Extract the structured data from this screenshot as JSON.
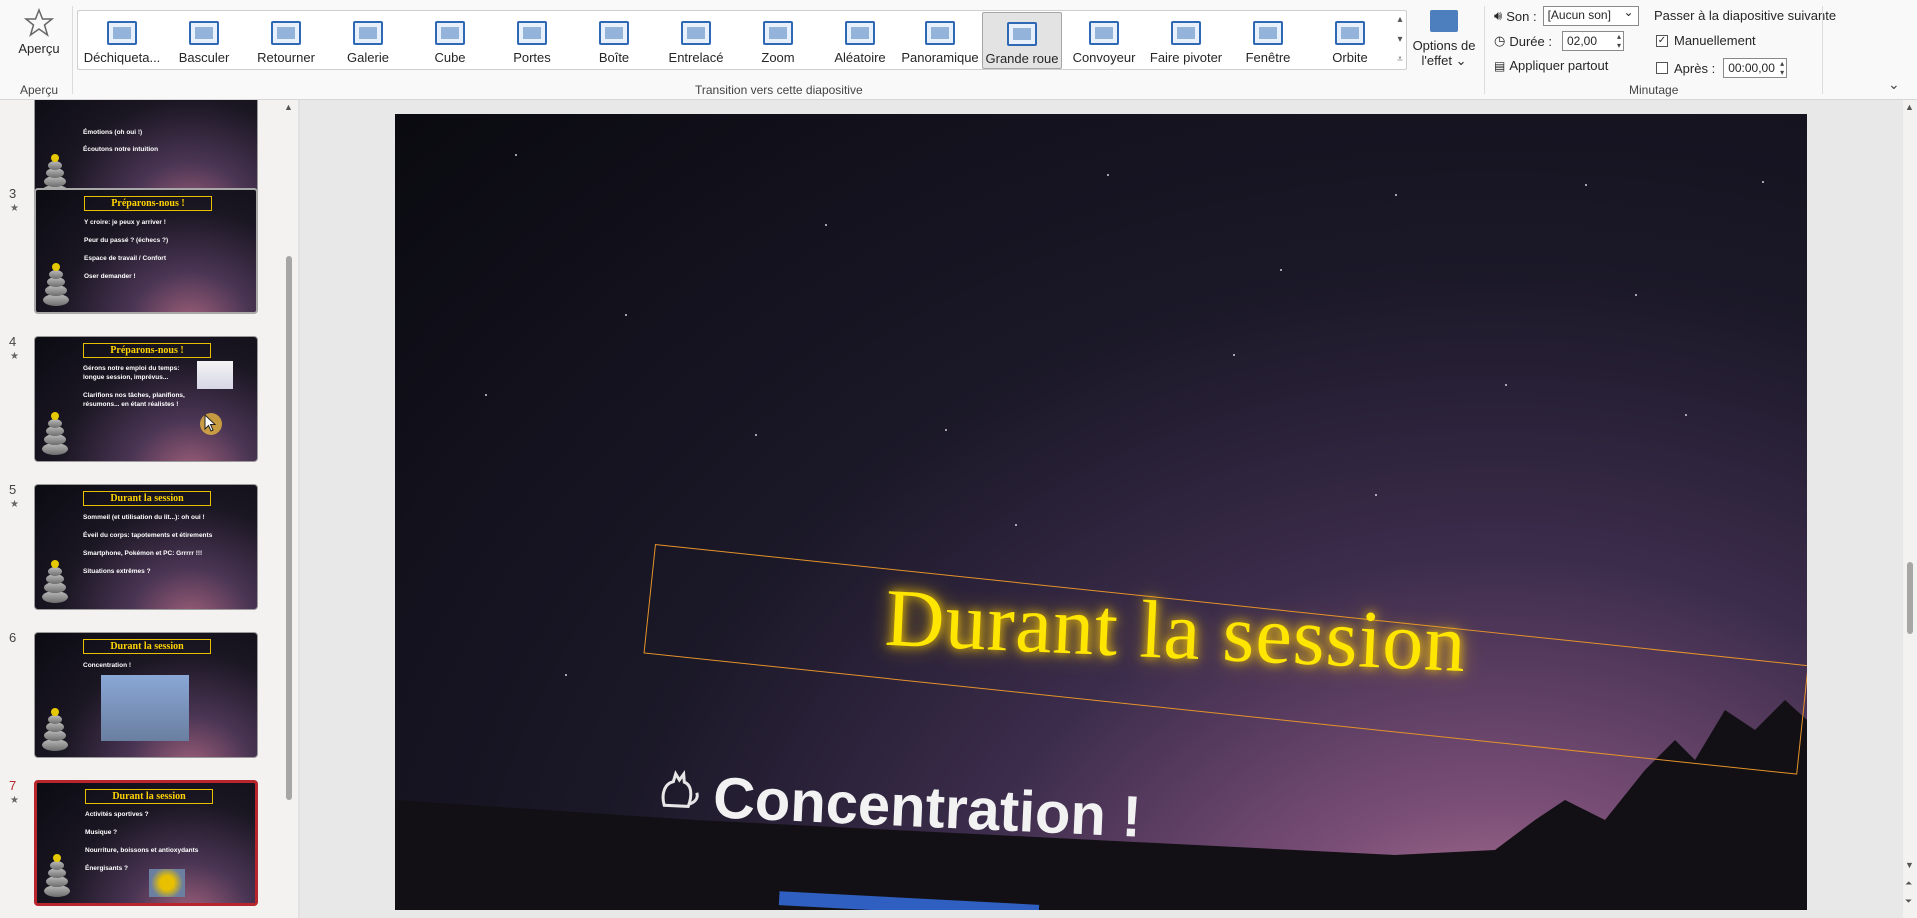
{
  "ribbon": {
    "preview": {
      "label": "Aperçu",
      "group_label": "Aperçu"
    },
    "transitions_group_label": "Transition vers cette diapositive",
    "transitions": [
      {
        "label": "Déchiqueta..."
      },
      {
        "label": "Basculer"
      },
      {
        "label": "Retourner"
      },
      {
        "label": "Galerie"
      },
      {
        "label": "Cube"
      },
      {
        "label": "Portes"
      },
      {
        "label": "Boîte"
      },
      {
        "label": "Entrelacé"
      },
      {
        "label": "Zoom"
      },
      {
        "label": "Aléatoire"
      },
      {
        "label": "Panoramique"
      },
      {
        "label": "Grande roue",
        "selected": true
      },
      {
        "label": "Convoyeur"
      },
      {
        "label": "Faire pivoter"
      },
      {
        "label": "Fenêtre"
      },
      {
        "label": "Orbite"
      }
    ],
    "effect_options": {
      "line1": "Options de",
      "line2": "l'effet ⌄"
    },
    "timing": {
      "group_label": "Minutage",
      "sound_label": "Son :",
      "sound_value": "[Aucun son]",
      "duration_label": "Durée :",
      "duration_value": "02,00",
      "apply_all": "Appliquer partout",
      "advance_label": "Passer à la diapositive suivante",
      "on_click_label": "Manuellement",
      "on_click_checked": true,
      "after_label": "Après :",
      "after_checked": false,
      "after_value": "00:00,00"
    }
  },
  "thumbnails": [
    {
      "number": "",
      "title": "",
      "bullets": [
        "Émotions (oh oui !)",
        "Écoutons notre intuition"
      ]
    },
    {
      "number": "3",
      "title": "Préparons-nous !",
      "bullets": [
        "Y croire: je peux y arriver !",
        "Peur du passé ? (échecs ?)",
        "Espace de travail / Confort",
        "Oser demander !"
      ]
    },
    {
      "number": "4",
      "title": "Préparons-nous !",
      "bullets": [
        "Gérons notre emploi du temps: longue session, imprévus...",
        "Clarifions nos tâches, planifions, résumons... en étant réalistes !"
      ]
    },
    {
      "number": "5",
      "title": "Durant la session",
      "bullets": [
        "Sommeil (et utilisation du lit...): oh oui !",
        "Éveil du corps: tapotements et étirements",
        "Smartphone, Pokémon et PC: Grrrrr !!!",
        "Situations extrêmes ?"
      ]
    },
    {
      "number": "6",
      "title": "Durant la session",
      "bullets": [
        "Concentration !"
      ]
    },
    {
      "number": "7",
      "title": "Durant la session",
      "bullets": [
        "Activités sportives ?",
        "Musique ?",
        "Nourriture, boissons et antioxydants",
        "Énergisants ?"
      ]
    }
  ],
  "slide": {
    "title": "Durant la session",
    "bullet": "Concentration !"
  },
  "colors": {
    "title_yellow": "#ffe600",
    "current_slide_border": "#b8262d",
    "transition_icon_blue": "#2f68b3"
  }
}
